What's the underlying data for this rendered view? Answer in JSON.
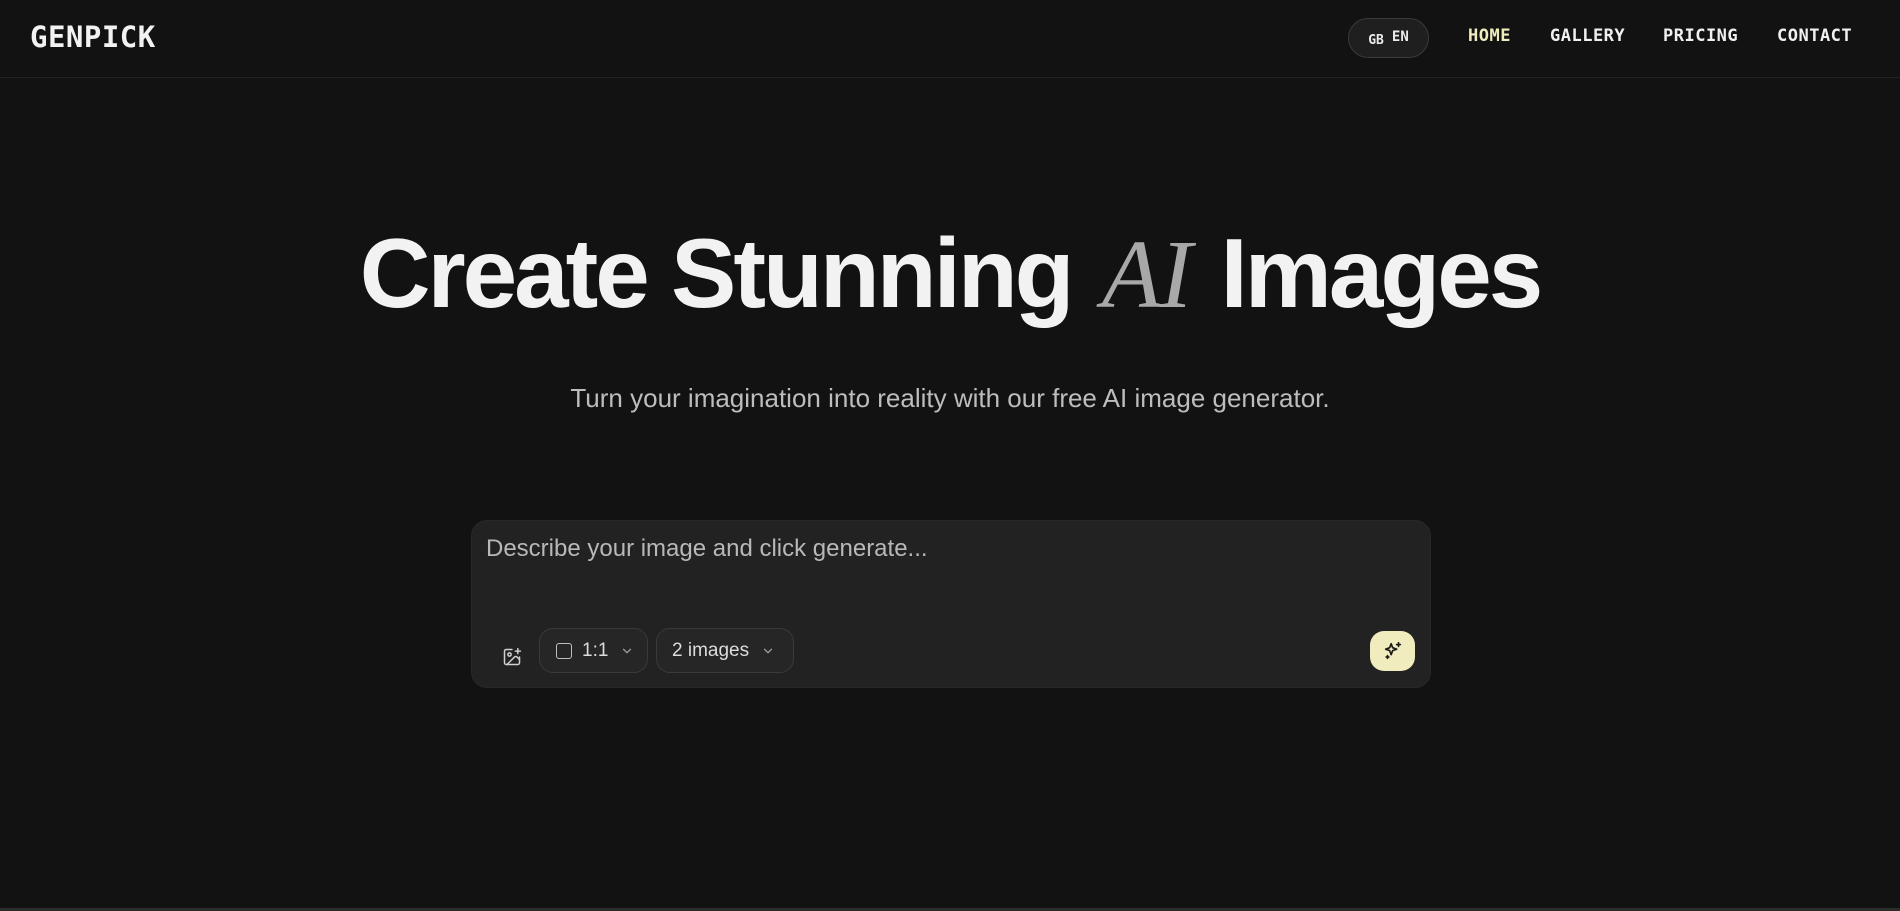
{
  "header": {
    "logo": "GENPICK",
    "language": {
      "flag": "GB",
      "code": "EN"
    },
    "nav": [
      {
        "label": "HOME",
        "active": true
      },
      {
        "label": "GALLERY",
        "active": false
      },
      {
        "label": "PRICING",
        "active": false
      },
      {
        "label": "CONTACT",
        "active": false
      }
    ]
  },
  "hero": {
    "title_before": "Create Stunning",
    "title_accent": "AI",
    "title_after": "Images",
    "subtitle": "Turn your imagination into reality with our free AI image generator."
  },
  "prompt": {
    "placeholder": "Describe your image and click generate...",
    "value": "",
    "aspect_ratio": "1:1",
    "image_count": "2 images"
  },
  "icons": {
    "image_upload": "image-plus-icon",
    "aspect_ratio": "square-icon",
    "dropdown": "chevron-down-icon",
    "generate": "sparkles-icon"
  },
  "colors": {
    "background": "#121212",
    "accent": "#f1ecbe",
    "panel": "#222222",
    "text": "#f2f2f2",
    "muted": "#bdbdbd"
  }
}
